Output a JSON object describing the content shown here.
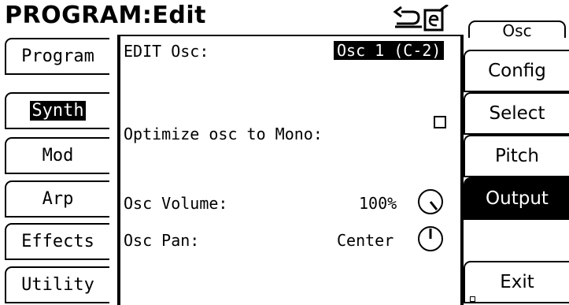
{
  "header": {
    "title": "PROGRAM:Edit",
    "top_tab": "Osc"
  },
  "left_tabs": [
    {
      "label": "Program",
      "selected": false
    },
    {
      "label": "Synth",
      "selected": true
    },
    {
      "label": "Mod",
      "selected": false
    },
    {
      "label": "Arp",
      "selected": false
    },
    {
      "label": "Effects",
      "selected": false
    },
    {
      "label": "Utility",
      "selected": false
    }
  ],
  "right_buttons": [
    {
      "label": "Config",
      "active": false
    },
    {
      "label": "Select",
      "active": false
    },
    {
      "label": "Pitch",
      "active": false
    },
    {
      "label": "Output",
      "active": true
    },
    {
      "label": "Exit",
      "active": false
    }
  ],
  "edit": {
    "edit_osc_label": "EDIT Osc:",
    "edit_osc_value": "Osc 1 (C-2)",
    "optimize_label": "Optimize osc to Mono:",
    "optimize_checked": false,
    "volume_label": "Osc Volume:",
    "volume_value": "100%",
    "pan_label": "Osc Pan:",
    "pan_value": "Center"
  },
  "icons": {
    "undo": "undo-icon",
    "edit_doc": "edit-document-icon",
    "volume_knob": "knob-icon",
    "pan_knob": "knob-icon"
  }
}
